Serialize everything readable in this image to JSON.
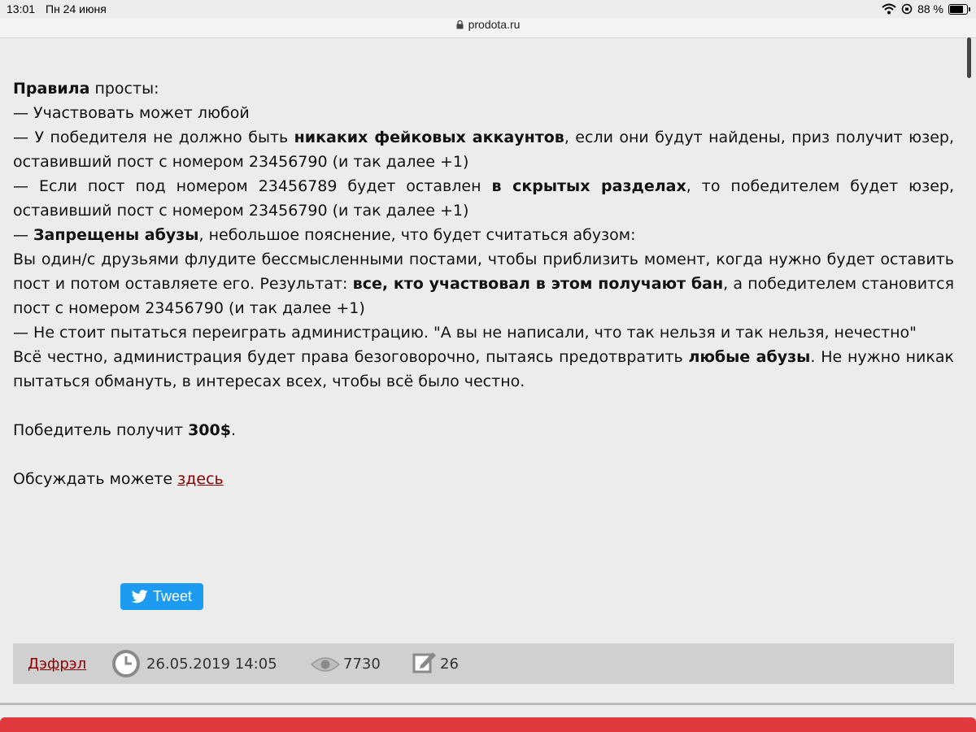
{
  "status": {
    "time": "13:01",
    "date": "Пн 24 июня",
    "battery": "88 %",
    "battery_level": 0.88
  },
  "url": "prodota.ru",
  "post": {
    "l1_b": "Правила",
    "l1_t": " просты:",
    "l2": "— Участвовать может любой",
    "l3_a": "— У победителя не должно быть ",
    "l3_b": "никаких фейковых аккаунтов",
    "l3_c": ", если они будут найдены, приз получит юзер, оставивший пост с номером 23456790 (и так далее +1)",
    "l4_a": "— Если пост под номером 23456789 будет оставлен ",
    "l4_b": "в скрытых разделах",
    "l4_c": ", то победителем будет юзер, оставивший пост с номером 23456790 (и так далее +1)",
    "l5_a": "— ",
    "l5_b": "Запрещены абузы",
    "l5_c": ", небольшое пояснение, что будет считаться абузом:",
    "l6_a": "Вы один/с друзьями флудите бессмысленными постами, чтобы приблизить момент, когда нужно будет оставить пост и потом оставляете его. Результат: ",
    "l6_b": "все, кто участвовал в этом получают бан",
    "l6_c": ", а победителем становится пост с номером 23456790 (и так далее +1)",
    "l7": "— Не стоит пытаться переиграть администрацию. \"А вы не написали, что так нельзя и так нельзя, нечестно\"",
    "l8_a": "Всё честно, администрация будет права безоговорочно, пытаясь предотвратить ",
    "l8_b": "любые абузы",
    "l8_c": ". Не нужно никак пытаться обмануть, в интересах всех, чтобы всё было честно.",
    "prize_a": "Победитель получит ",
    "prize_b": "300$",
    "prize_c": ".",
    "discuss_a": "Обсуждать можете ",
    "discuss_link": "здесь"
  },
  "tweet_label": "Tweet",
  "meta": {
    "author": "Дэфрэл",
    "date": "26.05.2019 14:05",
    "views": "7730",
    "comments": "26"
  },
  "colors": {
    "link": "#8b0000",
    "tweet": "#1d9bf0",
    "footer": "#e0393e"
  }
}
